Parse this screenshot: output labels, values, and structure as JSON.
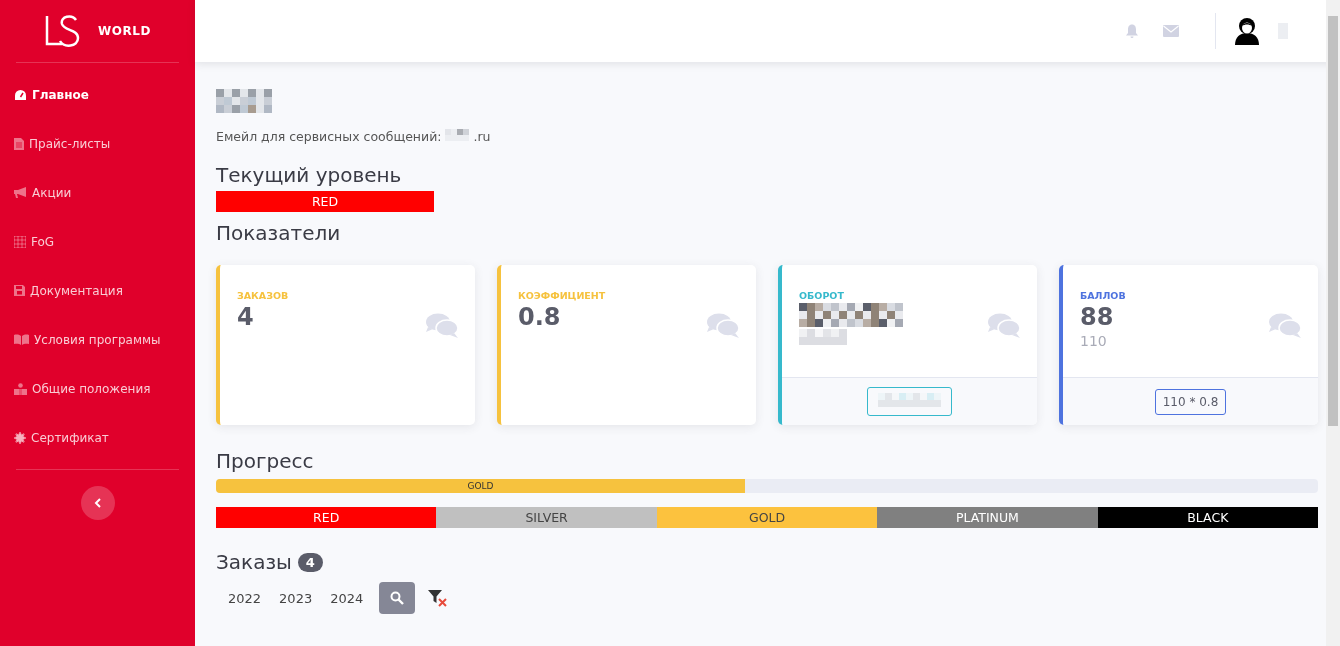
{
  "sidebar": {
    "logo_text": "WORLD",
    "items": [
      {
        "label": "Главное",
        "selected": true
      },
      {
        "label": "Прайс-листы",
        "selected": false
      },
      {
        "label": "Акции",
        "selected": false
      },
      {
        "label": "FoG",
        "selected": false
      },
      {
        "label": "Документация",
        "selected": false
      },
      {
        "label": "Условия программы",
        "selected": false
      },
      {
        "label": "Общие положения",
        "selected": false
      },
      {
        "label": "Сертификат",
        "selected": false
      }
    ]
  },
  "profile": {
    "email_label": "Емейл для сервисных сообщений:",
    "email_suffix": ".ru"
  },
  "current_level": {
    "heading": "Текущий уровень",
    "label": "RED",
    "color": "#ff0000"
  },
  "indicators": {
    "heading": "Показатели",
    "cards": [
      {
        "title": "ЗАКАЗОВ",
        "value": "4",
        "color": "#f6c23e"
      },
      {
        "title": "КОЭФФИЦИЕНТ",
        "value": "0.8",
        "color": "#f6c23e"
      },
      {
        "title": "ОБОРОТ",
        "color": "#36b9cc",
        "kind": "hidden",
        "footer": {
          "kind": "hidden"
        }
      },
      {
        "title": "БАЛЛОВ",
        "value": "88",
        "subvalue": "110",
        "color": "#4e73df",
        "footer": {
          "kind": "text",
          "text": "110 * 0.8"
        }
      }
    ]
  },
  "progress": {
    "heading": "Прогресс",
    "label": "GOLD",
    "level": 0.48,
    "color": "#f6c23e"
  },
  "levels": [
    {
      "label": "RED",
      "color": "#ff0000"
    },
    {
      "label": "SILVER",
      "color": "#c0c0c0"
    },
    {
      "label": "GOLD",
      "color": "#fcc23e"
    },
    {
      "label": "PLATINUM",
      "color": "#808080"
    },
    {
      "label": "BLACK",
      "color": "#000000"
    }
  ],
  "orders": {
    "heading": "Заказы",
    "count": "4",
    "years": [
      {
        "label": "2022"
      },
      {
        "label": "2023"
      },
      {
        "label": "2024"
      }
    ]
  }
}
